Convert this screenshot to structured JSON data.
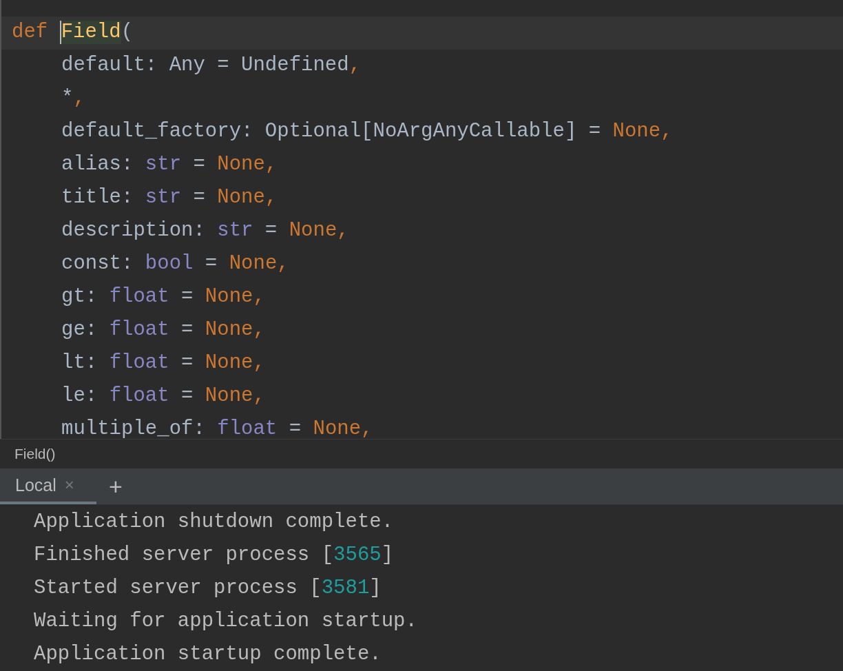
{
  "editor": {
    "lines": [
      {
        "current": true,
        "tokens": [
          {
            "text": "def ",
            "kind": "keyword"
          },
          {
            "text": "Field",
            "kind": "func",
            "caret": true
          },
          {
            "text": "(",
            "kind": "plain"
          }
        ],
        "children": [
          {
            "tokens": [
              {
                "text": "default: Any = Undefined",
                "kind": "plain"
              },
              {
                "text": ",",
                "kind": "keyword"
              }
            ]
          },
          {
            "tokens": [
              {
                "text": "*",
                "kind": "plain"
              },
              {
                "text": ",",
                "kind": "keyword"
              }
            ]
          },
          {
            "tokens": [
              {
                "text": "default_factory: Optional[NoArgAnyCallable] = ",
                "kind": "plain"
              },
              {
                "text": "None,",
                "kind": "keyword"
              }
            ]
          },
          {
            "tokens": [
              {
                "text": "alias: ",
                "kind": "plain"
              },
              {
                "text": "str",
                "kind": "type"
              },
              {
                "text": " = ",
                "kind": "plain"
              },
              {
                "text": "None,",
                "kind": "keyword"
              }
            ]
          },
          {
            "tokens": [
              {
                "text": "title: ",
                "kind": "plain"
              },
              {
                "text": "str",
                "kind": "type"
              },
              {
                "text": " = ",
                "kind": "plain"
              },
              {
                "text": "None,",
                "kind": "keyword"
              }
            ]
          },
          {
            "tokens": [
              {
                "text": "description: ",
                "kind": "plain"
              },
              {
                "text": "str",
                "kind": "type"
              },
              {
                "text": " = ",
                "kind": "plain"
              },
              {
                "text": "None,",
                "kind": "keyword"
              }
            ]
          },
          {
            "tokens": [
              {
                "text": "const: ",
                "kind": "plain"
              },
              {
                "text": "bool",
                "kind": "type"
              },
              {
                "text": " = ",
                "kind": "plain"
              },
              {
                "text": "None,",
                "kind": "keyword"
              }
            ]
          },
          {
            "tokens": [
              {
                "text": "gt: ",
                "kind": "plain"
              },
              {
                "text": "float",
                "kind": "type"
              },
              {
                "text": " = ",
                "kind": "plain"
              },
              {
                "text": "None,",
                "kind": "keyword"
              }
            ]
          },
          {
            "tokens": [
              {
                "text": "ge: ",
                "kind": "plain"
              },
              {
                "text": "float",
                "kind": "type"
              },
              {
                "text": " = ",
                "kind": "plain"
              },
              {
                "text": "None,",
                "kind": "keyword"
              }
            ]
          },
          {
            "tokens": [
              {
                "text": "lt: ",
                "kind": "plain"
              },
              {
                "text": "float",
                "kind": "type"
              },
              {
                "text": " = ",
                "kind": "plain"
              },
              {
                "text": "None,",
                "kind": "keyword"
              }
            ]
          },
          {
            "tokens": [
              {
                "text": "le: ",
                "kind": "plain"
              },
              {
                "text": "float",
                "kind": "type"
              },
              {
                "text": " = ",
                "kind": "plain"
              },
              {
                "text": "None,",
                "kind": "keyword"
              }
            ]
          },
          {
            "tokens": [
              {
                "text": "multiple_of: ",
                "kind": "plain"
              },
              {
                "text": "float",
                "kind": "type"
              },
              {
                "text": " = ",
                "kind": "plain"
              },
              {
                "text": "None,",
                "kind": "keyword"
              }
            ]
          }
        ]
      }
    ]
  },
  "breadcrumb": "Field()",
  "terminal": {
    "tabs": [
      {
        "label": "Local",
        "selected": true,
        "close": "×"
      }
    ],
    "add": "+",
    "lines": [
      [
        {
          "text": "Application shutdown complete.",
          "kind": "plain"
        }
      ],
      [
        {
          "text": "Finished server process [",
          "kind": "plain"
        },
        {
          "text": "3565",
          "kind": "number"
        },
        {
          "text": "]",
          "kind": "plain"
        }
      ],
      [
        {
          "text": "Started server process [",
          "kind": "plain"
        },
        {
          "text": "3581",
          "kind": "number"
        },
        {
          "text": "]",
          "kind": "plain"
        }
      ],
      [
        {
          "text": "Waiting for application startup.",
          "kind": "plain"
        }
      ],
      [
        {
          "text": "Application startup complete.",
          "kind": "plain"
        }
      ]
    ]
  }
}
